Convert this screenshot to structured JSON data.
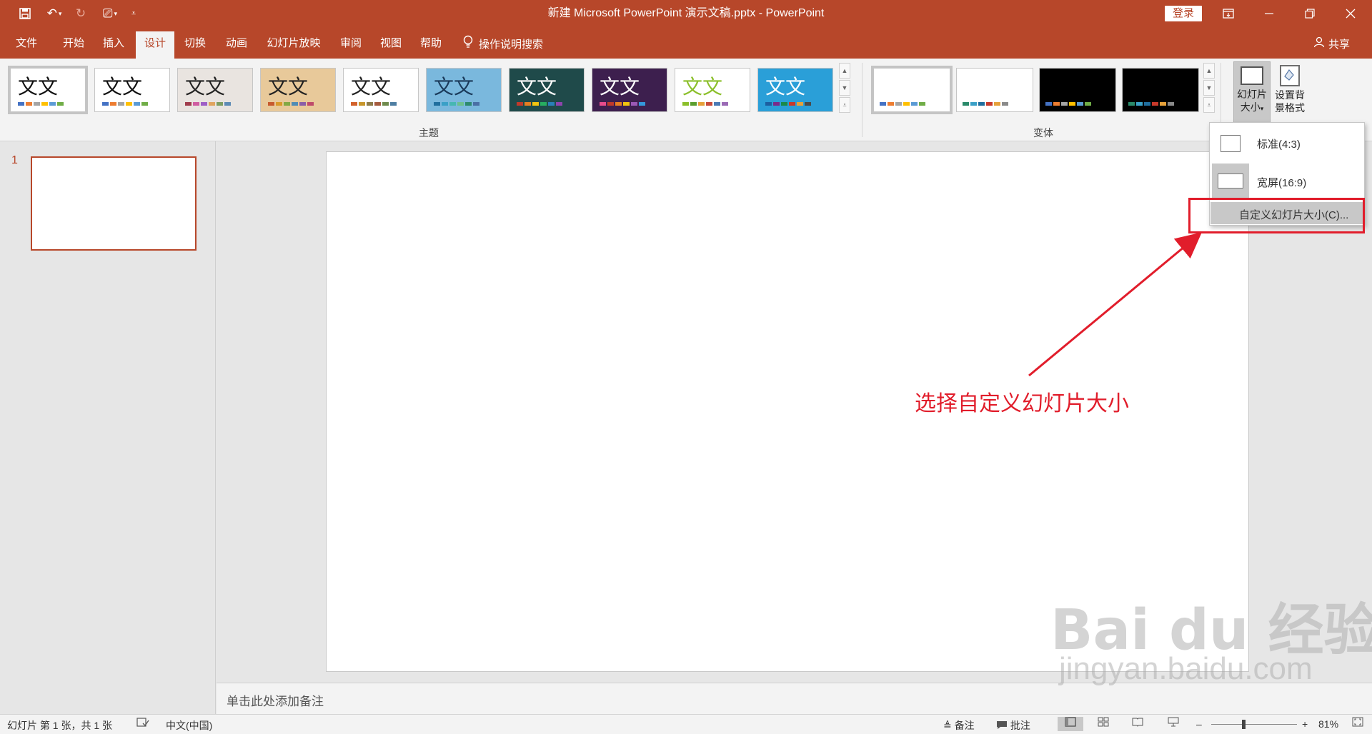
{
  "window": {
    "title": "新建 Microsoft PowerPoint 演示文稿.pptx  -  PowerPoint",
    "login_label": "登录",
    "qat_icons": [
      "save-icon",
      "undo-icon",
      "redo-icon",
      "present-from-start-icon",
      "customize-qat-icon"
    ]
  },
  "tabs": [
    {
      "label": "文件"
    },
    {
      "label": "开始"
    },
    {
      "label": "插入"
    },
    {
      "label": "设计",
      "active": true
    },
    {
      "label": "切换"
    },
    {
      "label": "动画"
    },
    {
      "label": "幻灯片放映"
    },
    {
      "label": "审阅"
    },
    {
      "label": "视图"
    },
    {
      "label": "帮助"
    }
  ],
  "tell_me": "操作说明搜索",
  "share": "共享",
  "ribbon": {
    "themes_label": "主题",
    "variants_label": "变体",
    "theme_sample_text": "文文",
    "themes": [
      {
        "bg": "#ffffff",
        "fg": "#111111",
        "colors": [
          "#4472c4",
          "#ed7d31",
          "#a5a5a5",
          "#ffc000",
          "#5b9bd5",
          "#70ad47"
        ]
      },
      {
        "bg": "#ffffff",
        "fg": "#111111",
        "colors": [
          "#4472c4",
          "#ed7d31",
          "#a5a5a5",
          "#ffc000",
          "#5b9bd5",
          "#70ad47"
        ]
      },
      {
        "bg": "#e9e4e0",
        "fg": "#222222",
        "colors": [
          "#a03c4c",
          "#d05ba0",
          "#9e5ec7",
          "#e0a45e",
          "#7d9d62",
          "#5d8bb5"
        ]
      },
      {
        "bg": "#e8c99a",
        "fg": "#222222",
        "colors": [
          "#c75a2e",
          "#d99a2a",
          "#83a944",
          "#4f8cb5",
          "#8a5ea8",
          "#bf4a6a"
        ]
      },
      {
        "bg": "#ffffff",
        "fg": "#222222",
        "colors": [
          "#d3622b",
          "#c7962b",
          "#8c7b4a",
          "#a55b3e",
          "#6f8a4c",
          "#4e7ea2"
        ]
      },
      {
        "bg": "#7ab8dd",
        "fg": "#1a3a5a",
        "colors": [
          "#1f6e9e",
          "#3aa0c7",
          "#46b7b2",
          "#6bbf8e",
          "#2d8a6e",
          "#4a6fa5"
        ]
      },
      {
        "bg": "#1f4a4a",
        "fg": "#ffffff",
        "colors": [
          "#c0392b",
          "#e67e22",
          "#f1c40f",
          "#27ae60",
          "#2980b9",
          "#8e44ad"
        ]
      },
      {
        "bg": "#3d1f4e",
        "fg": "#ffffff",
        "colors": [
          "#e74c8c",
          "#c0392b",
          "#e67e22",
          "#f1c40f",
          "#9b59b6",
          "#3498db"
        ]
      },
      {
        "bg": "#ffffff",
        "fg": "#8bbf2a",
        "colors": [
          "#8bbf2a",
          "#5a9e2e",
          "#e6a13a",
          "#c74a3a",
          "#4a7ab5",
          "#9a6ab5"
        ]
      },
      {
        "bg": "#2a9fd8",
        "fg": "#ffffff",
        "colors": [
          "#1c5fa0",
          "#7a2a8a",
          "#1a8a4a",
          "#c7392b",
          "#e6a13a",
          "#4a4a4a"
        ]
      }
    ],
    "variants": [
      {
        "bg": "#ffffff",
        "colors": [
          "#4472c4",
          "#ed7d31",
          "#a5a5a5",
          "#ffc000",
          "#5b9bd5",
          "#70ad47"
        ]
      },
      {
        "bg": "#ffffff",
        "colors": [
          "#2a8a6a",
          "#3aa0c7",
          "#1f6e9e",
          "#c7392b",
          "#e6a13a",
          "#8a8a8a"
        ]
      },
      {
        "bg": "#000000",
        "colors": [
          "#4472c4",
          "#ed7d31",
          "#a5a5a5",
          "#ffc000",
          "#5b9bd5",
          "#70ad47"
        ]
      },
      {
        "bg": "#000000",
        "colors": [
          "#2a8a6a",
          "#3aa0c7",
          "#1f6e9e",
          "#c7392b",
          "#e6a13a",
          "#8a8a8a"
        ]
      }
    ],
    "slide_size_label_1": "幻灯片",
    "slide_size_label_2": "大小",
    "bg_format_label_1": "设置背",
    "bg_format_label_2": "景格式"
  },
  "dropdown": {
    "standard": "标准(4:3)",
    "widescreen": "宽屏(16:9)",
    "custom": "自定义幻灯片大小(C)..."
  },
  "thumbnails": {
    "slide_number": "1"
  },
  "notes_placeholder": "单击此处添加备注",
  "annotation": {
    "text": "选择自定义幻灯片大小",
    "color": "#e11d2b"
  },
  "watermark": {
    "main": "Bai du 经验",
    "sub": "jingyan.baidu.com"
  },
  "status": {
    "slide_info": "幻灯片 第 1 张，共 1 张",
    "language": "中文(中国)",
    "notes": "备注",
    "comments": "批注",
    "zoom": "81%"
  },
  "colors": {
    "accent": "#b7472a",
    "ribbon_bg": "#f3f3f3"
  }
}
